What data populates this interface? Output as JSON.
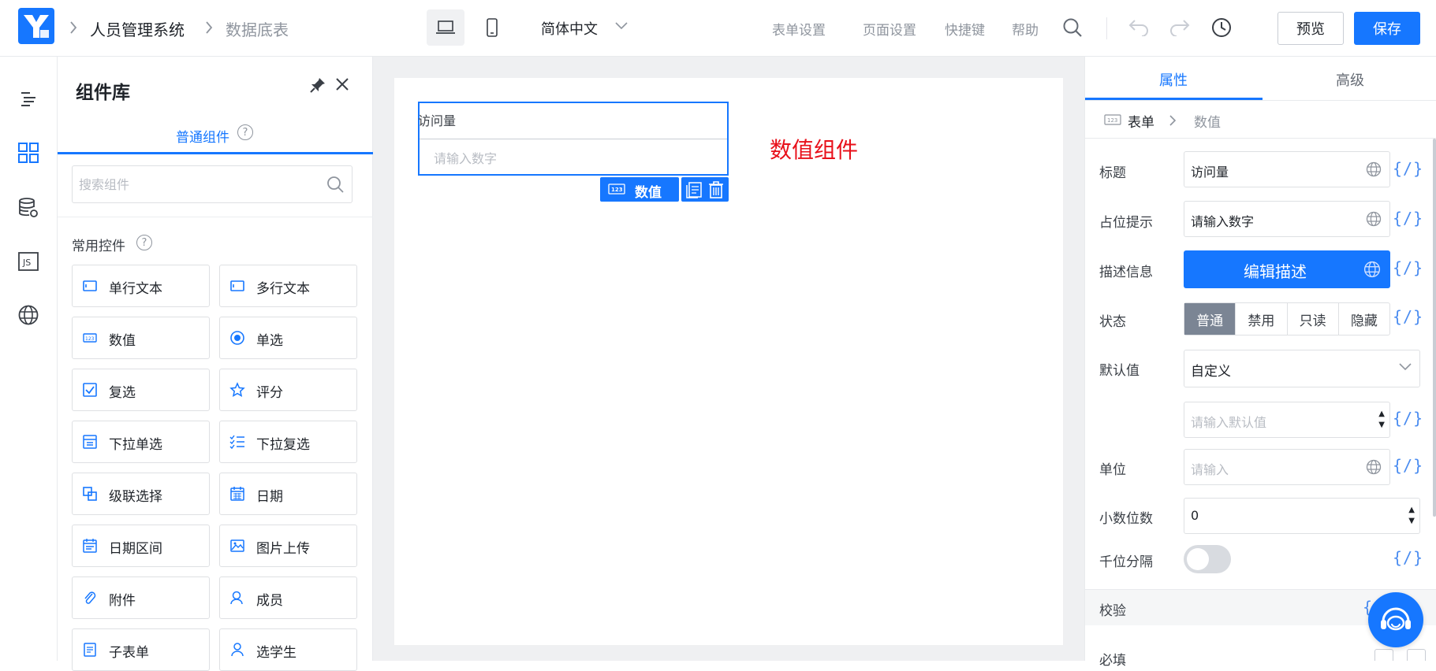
{
  "header": {
    "breadcrumb": [
      "人员管理系统",
      "数据底表"
    ],
    "language": "简体中文",
    "links": [
      "表单设置",
      "页面设置",
      "快捷键",
      "帮助"
    ],
    "preview_label": "预览",
    "save_label": "保存",
    "accent_color": "#1677ff"
  },
  "rail": {
    "items": [
      "outline-icon",
      "components-icon",
      "datasource-icon",
      "js-icon",
      "globe-icon"
    ],
    "active": "components-icon"
  },
  "panel": {
    "title": "组件库",
    "tab_label": "普通组件",
    "search_placeholder": "搜索组件",
    "section_title": "常用控件",
    "components": [
      {
        "label": "单行文本",
        "icon": "single-line-text-icon"
      },
      {
        "label": "多行文本",
        "icon": "multi-line-text-icon"
      },
      {
        "label": "数值",
        "icon": "number-icon"
      },
      {
        "label": "单选",
        "icon": "radio-icon"
      },
      {
        "label": "复选",
        "icon": "checkbox-icon"
      },
      {
        "label": "评分",
        "icon": "star-icon"
      },
      {
        "label": "下拉单选",
        "icon": "dropdown-single-icon"
      },
      {
        "label": "下拉复选",
        "icon": "dropdown-multi-icon"
      },
      {
        "label": "级联选择",
        "icon": "cascade-icon"
      },
      {
        "label": "日期",
        "icon": "calendar-icon"
      },
      {
        "label": "日期区间",
        "icon": "date-range-icon"
      },
      {
        "label": "图片上传",
        "icon": "image-upload-icon"
      },
      {
        "label": "附件",
        "icon": "paperclip-icon"
      },
      {
        "label": "成员",
        "icon": "user-icon"
      },
      {
        "label": "子表单",
        "icon": "subform-icon"
      },
      {
        "label": "选学生",
        "icon": "student-icon"
      }
    ]
  },
  "canvas": {
    "field_label": "访问量",
    "field_placeholder": "请输入数字",
    "selection_tag": "数值",
    "annotation": "数值组件",
    "annotation_color": "#e8101a"
  },
  "props": {
    "tabs": [
      "属性",
      "高级"
    ],
    "breadcrumb": [
      "表单",
      "数值"
    ],
    "title_label": "标题",
    "title_value": "访问量",
    "placeholder_label": "占位提示",
    "placeholder_value": "请输入数字",
    "description_label": "描述信息",
    "description_button": "编辑描述",
    "status_label": "状态",
    "status_options": [
      "普通",
      "禁用",
      "只读",
      "隐藏"
    ],
    "status_selected": "普通",
    "default_label": "默认值",
    "default_mode": "自定义",
    "default_placeholder": "请输入默认值",
    "unit_label": "单位",
    "unit_placeholder": "请输入",
    "decimals_label": "小数位数",
    "decimals_value": "0",
    "thousands_label": "千位分隔",
    "thousands_enabled": false,
    "fx_symbol": "{/}",
    "validation_label": "校验",
    "required_label": "必填"
  }
}
